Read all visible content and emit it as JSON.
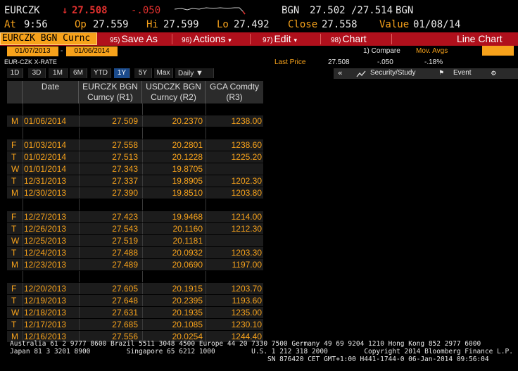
{
  "quote": {
    "ticker": "EURCZK",
    "arrow": "↓",
    "last": "27.508",
    "change": "-.050",
    "source": "BGN",
    "bid_ask": "27.502 /27.514",
    "source2": "BGN",
    "at_label": "At",
    "at_time": "9:56",
    "op_label": "Op",
    "open": "27.559",
    "hi_label": "Hi",
    "high": "27.599",
    "lo_label": "Lo",
    "low": "27.492",
    "close_label": "Close",
    "close": "27.558",
    "value_label": "Value",
    "value_date": "01/08/14"
  },
  "toolbar": {
    "security": "EURCZK BGN Curnc",
    "save_num": "95)",
    "save": "Save As",
    "actions_num": "96)",
    "actions": "Actions",
    "edit_num": "97)",
    "edit": "Edit",
    "chart_num": "98)",
    "chart": "Chart",
    "view": "Line Chart"
  },
  "range": {
    "start": "01/07/2013",
    "dash": "-",
    "end": "01/06/2014",
    "compare": "1) Compare",
    "mov_avgs": "Mov. Avgs"
  },
  "info": {
    "name": "EUR-CZK X-RATE",
    "last_price_label": "Last Price",
    "last_price": "27.508",
    "change": "-.050",
    "pct": "-.18%"
  },
  "periods": [
    "1D",
    "3D",
    "1M",
    "6M",
    "YTD",
    "1Y",
    "5Y",
    "Max"
  ],
  "active_period": "1Y",
  "frequency": "Daily",
  "rightbar": {
    "security_study": "Security/Study",
    "event": "Event"
  },
  "table": {
    "headers": [
      {
        "l1": "Date",
        "l2": ""
      },
      {
        "l1": "EURCZK BGN",
        "l2": "Curncy  (R1)"
      },
      {
        "l1": "USDCZK BGN",
        "l2": "Curncy  (R2)"
      },
      {
        "l1": "GCA Comdty",
        "l2": "(R3)"
      }
    ],
    "rows": [
      {
        "gap": true
      },
      {
        "d": "M",
        "date": "01/06/2014",
        "r1": "27.509",
        "r2": "20.2370",
        "r3": "1238.00"
      },
      {
        "gap": true
      },
      {
        "d": "F",
        "date": "01/03/2014",
        "r1": "27.558",
        "r2": "20.2801",
        "r3": "1238.60"
      },
      {
        "d": "T",
        "date": "01/02/2014",
        "r1": "27.513",
        "r2": "20.1228",
        "r3": "1225.20"
      },
      {
        "d": "W",
        "date": "01/01/2014",
        "r1": "27.343",
        "r2": "19.8705",
        "r3": ""
      },
      {
        "d": "T",
        "date": "12/31/2013",
        "r1": "27.337",
        "r2": "19.8905",
        "r3": "1202.30"
      },
      {
        "d": "M",
        "date": "12/30/2013",
        "r1": "27.390",
        "r2": "19.8510",
        "r3": "1203.80"
      },
      {
        "gap": true
      },
      {
        "d": "F",
        "date": "12/27/2013",
        "r1": "27.423",
        "r2": "19.9468",
        "r3": "1214.00"
      },
      {
        "d": "T",
        "date": "12/26/2013",
        "r1": "27.543",
        "r2": "20.1160",
        "r3": "1212.30"
      },
      {
        "d": "W",
        "date": "12/25/2013",
        "r1": "27.519",
        "r2": "20.1181",
        "r3": ""
      },
      {
        "d": "T",
        "date": "12/24/2013",
        "r1": "27.488",
        "r2": "20.0932",
        "r3": "1203.30"
      },
      {
        "d": "M",
        "date": "12/23/2013",
        "r1": "27.489",
        "r2": "20.0690",
        "r3": "1197.00"
      },
      {
        "gap": true
      },
      {
        "d": "F",
        "date": "12/20/2013",
        "r1": "27.605",
        "r2": "20.1915",
        "r3": "1203.70"
      },
      {
        "d": "T",
        "date": "12/19/2013",
        "r1": "27.648",
        "r2": "20.2395",
        "r3": "1193.60"
      },
      {
        "d": "W",
        "date": "12/18/2013",
        "r1": "27.631",
        "r2": "20.1935",
        "r3": "1235.00"
      },
      {
        "d": "T",
        "date": "12/17/2013",
        "r1": "27.685",
        "r2": "20.1085",
        "r3": "1230.10"
      },
      {
        "d": "M",
        "date": "12/16/2013",
        "r1": "27.556",
        "r2": "20.0254",
        "r3": "1244.40"
      }
    ]
  },
  "footer": {
    "line1": "Australia 61 2 9777 8600 Brazil 5511 3048 4500 Europe 44 20 7330 7500 Germany 49 69 9204 1210 Hong Kong 852 2977 6000",
    "line2": "Japan 81 3 3201 8900         Singapore 65 6212 1000         U.S. 1 212 318 2000         Copyright 2014 Bloomberg Finance L.P.",
    "line3": "SN 876420 CET  GMT+1:00 H441-1744-0 06-Jan-2014 09:56:04"
  },
  "colors": {
    "accent": "#f7a21b",
    "toolbar_red": "#b0101c",
    "down_red": "#e0302e",
    "active_blue": "#1b4b8c"
  }
}
